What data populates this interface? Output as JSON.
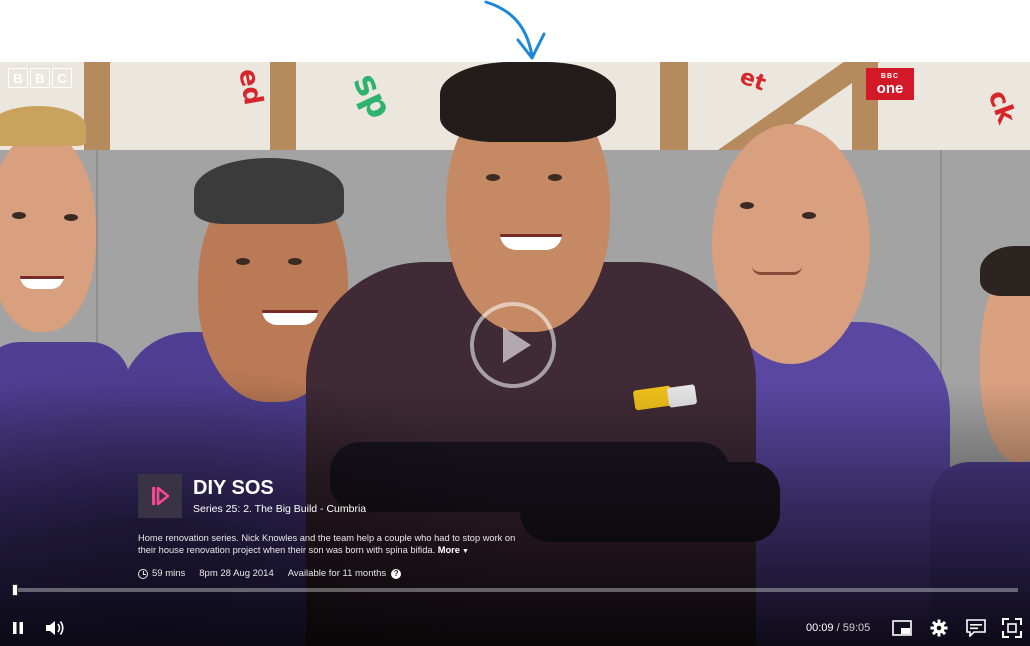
{
  "broadcaster_logo": "BBC",
  "channel_logo": {
    "top": "BBC",
    "bottom": "one",
    "color": "#d31928"
  },
  "annotation_arrow_color": "#1e88d8",
  "programme": {
    "title": "DIY SOS",
    "subtitle": "Series 25: 2. The Big Build - Cumbria",
    "description": "Home renovation series. Nick Knowles and the team help a couple who had to stop work on their house renovation project when their son was born with spina bifida.",
    "more_label": "More",
    "duration": "59 mins",
    "broadcast": "8pm 28 Aug 2014",
    "availability": "Available for 11 months"
  },
  "player": {
    "current_time": "00:09",
    "total_time": "59:05",
    "progress_fraction": 0.0025,
    "icons": [
      "pause-icon",
      "volume-icon",
      "cast-icon",
      "settings-icon",
      "subtitles-icon",
      "fullscreen-icon",
      "play-icon",
      "iplayer-icon"
    ]
  }
}
